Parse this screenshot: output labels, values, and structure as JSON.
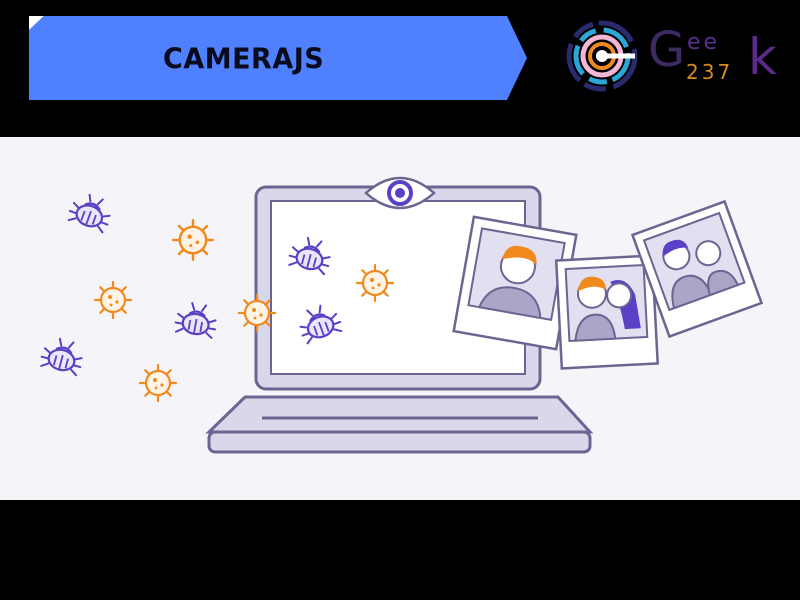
{
  "banner": {
    "title": "CAMERAJS",
    "bar_color": "#4f80ff"
  },
  "logo": {
    "letter_g": "G",
    "ee": "ee",
    "digits": "237",
    "letter_k": "k"
  },
  "colors": {
    "purple": "#5b3fc4",
    "orange": "#f08a1e",
    "laptop_fill": "#d9d7ea",
    "laptop_stroke": "#6b6592",
    "scene_bg": "#f5f5f9"
  },
  "illustration": {
    "icons": [
      "eye-icon",
      "bug-icon",
      "virus-icon",
      "photo-icon",
      "laptop-icon"
    ]
  }
}
